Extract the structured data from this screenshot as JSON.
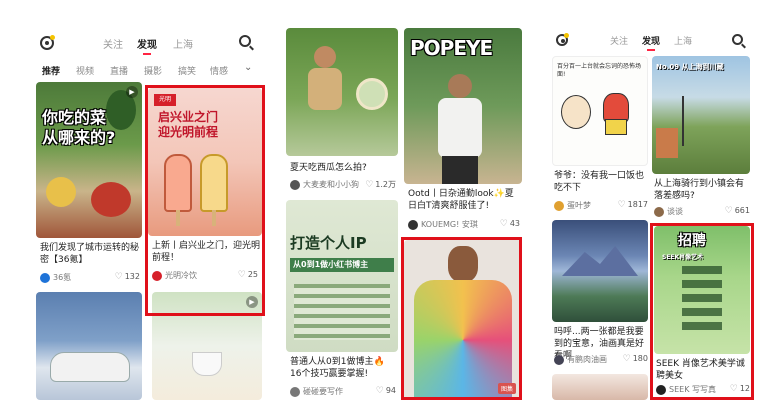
{
  "phone1": {
    "tabs": [
      "关注",
      "发现",
      "上海"
    ],
    "active_tab": 1,
    "categories": [
      "推荐",
      "视频",
      "直播",
      "摄影",
      "搞笑",
      "情感"
    ],
    "cards": [
      {
        "overlay": "你吃的菜\n从哪来的?",
        "caption": "我们发现了城市运转的秘密【36氪】",
        "author": "36氪",
        "likes": "132"
      },
      {
        "overlay": "光明",
        "overlay2": "启兴业之门\n迎光明前程",
        "caption": "上新丨启兴业之门，迎光明前程！",
        "author": "光明冷饮",
        "likes": "25"
      }
    ]
  },
  "phone2": {
    "cards": [
      {
        "caption": "夏天吃西瓜怎么拍?",
        "author": "大麦麦和小小狗",
        "likes": "1.2万"
      },
      {
        "overlay": "POPEYE",
        "caption": "Ootd丨日杂通勤look✨夏日白T清爽舒服佳了!",
        "author": "KOUEMG! 安琪",
        "likes": "43"
      },
      {
        "overlay": "打造个人IP",
        "overlay2": "从0到1做小红书博主",
        "caption": "普通人从0到1做博主🔥 16个技巧赢要掌握!",
        "author": "碰碰要写作",
        "likes": "94"
      },
      {
        "badge": "图集"
      }
    ]
  },
  "phone3": {
    "tabs": [
      "关注",
      "发现",
      "上海"
    ],
    "active_tab": 1,
    "cards": [
      {
        "overlay": "百分百一上台就会忘词的恐怖场面!",
        "caption": "爷爷：没有我一口饭也吃不下",
        "author": "蛋叶梦",
        "likes": "1817"
      },
      {
        "overlay": "No.09 从上海到川藏",
        "caption": "从上海骑行到小镇会有落差感吗?",
        "author": "谈谈",
        "likes": "661"
      },
      {
        "caption": "吗呼...两一张都是我要到的宝意，油画真是好看啊",
        "author": "有鹏肉油画",
        "likes": "180"
      },
      {
        "overlay": "招聘",
        "overlay2": "SEEK肖像艺术",
        "caption": "SEEK 肖像艺术美学诚聘美女",
        "author": "SEEK 写写真",
        "likes": "12"
      }
    ]
  },
  "colors": {
    "accent": "#ff2442",
    "highlight": "#e0101a"
  }
}
